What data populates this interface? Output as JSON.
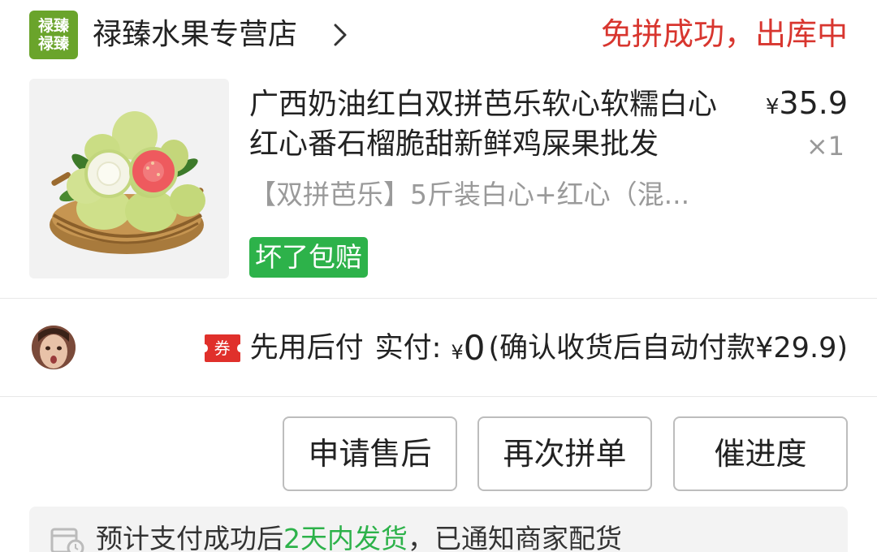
{
  "shop": {
    "logo_line1": "禄臻",
    "logo_line2": "禄臻",
    "name": "禄臻水果专营店",
    "chevron_icon": "chevron-right-icon"
  },
  "order": {
    "status": "免拼成功，出库中",
    "status_color": "#d8362f"
  },
  "product": {
    "title": "广西奶油红白双拼芭乐软心软糯白心红心番石榴脆甜新鲜鸡屎果批发",
    "price_symbol": "¥",
    "price": "35.9",
    "quantity": "×1",
    "spec": "【双拼芭乐】5斤装白心+红心（混...",
    "badge": "坏了包赔",
    "badge_color": "#2db24a"
  },
  "payment": {
    "coupon_label": "券",
    "method": "先用后付",
    "paid_label": "实付:",
    "paid_symbol": "¥",
    "paid_amount": "0",
    "note": "(确认收货后自动付款¥29.9)"
  },
  "actions": {
    "after_sale": "申请售后",
    "rebuy": "再次拼单",
    "urge": "催进度"
  },
  "shipping": {
    "icon": "calendar-clock-icon",
    "text_before": "预计支付成功后",
    "highlight": "2天内发货",
    "text_after": "，已通知商家配货",
    "highlight_color": "#2db24a"
  }
}
